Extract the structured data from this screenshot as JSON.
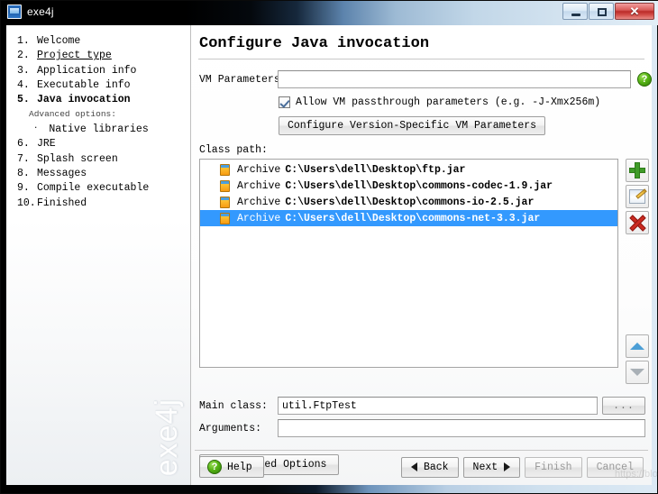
{
  "window": {
    "title": "exe4j",
    "app_icon": "exe4j-app-icon",
    "controls": {
      "minimize": "minimize-icon",
      "maximize": "maximize-icon",
      "close": "✕"
    }
  },
  "sidebar": {
    "steps": [
      {
        "num": "1.",
        "label": "Welcome",
        "state": "done"
      },
      {
        "num": "2.",
        "label": "Project type",
        "state": "visited"
      },
      {
        "num": "3.",
        "label": "Application info",
        "state": "done"
      },
      {
        "num": "4.",
        "label": "Executable info",
        "state": "done"
      },
      {
        "num": "5.",
        "label": "Java invocation",
        "state": "current"
      }
    ],
    "advanced_label": "Advanced options:",
    "advanced_items": [
      {
        "bullet": "·",
        "label": "Native libraries"
      }
    ],
    "steps_after": [
      {
        "num": "6.",
        "label": "JRE",
        "state": "todo"
      },
      {
        "num": "7.",
        "label": "Splash screen",
        "state": "todo"
      },
      {
        "num": "8.",
        "label": "Messages",
        "state": "todo"
      },
      {
        "num": "9.",
        "label": "Compile executable",
        "state": "todo"
      },
      {
        "num": "10.",
        "label": "Finished",
        "state": "todo"
      }
    ],
    "watermark": "exe4j"
  },
  "main": {
    "page_title": "Configure Java invocation",
    "vm_parameters": {
      "label": "VM Parameters:",
      "value": "",
      "help_icon": "?"
    },
    "passthrough": {
      "label": "Allow VM passthrough parameters (e.g. -J-Xmx256m)",
      "checked": true
    },
    "version_specific_button": "Configure Version-Specific VM Parameters",
    "classpath": {
      "label": "Class path:",
      "items": [
        {
          "type": "Archive",
          "path": "C:\\Users\\dell\\Desktop\\ftp.jar",
          "selected": false
        },
        {
          "type": "Archive",
          "path": "C:\\Users\\dell\\Desktop\\commons-codec-1.9.jar",
          "selected": false
        },
        {
          "type": "Archive",
          "path": "C:\\Users\\dell\\Desktop\\commons-io-2.5.jar",
          "selected": false
        },
        {
          "type": "Archive",
          "path": "C:\\Users\\dell\\Desktop\\commons-net-3.3.jar",
          "selected": true
        }
      ],
      "tools": {
        "add": "add-icon",
        "edit": "edit-icon",
        "remove": "remove-icon",
        "move_up": "move-up-icon",
        "move_down": "move-down-icon"
      }
    },
    "main_class": {
      "label": "Main class:",
      "value": "util.FtpTest",
      "browse_label": "..."
    },
    "arguments": {
      "label": "Arguments:",
      "value": "",
      "placeholder": ""
    },
    "advanced_options_button": "Advanced Options"
  },
  "footer": {
    "help": "Help",
    "back": "Back",
    "next": "Next",
    "finish": "Finish",
    "cancel": "Cancel",
    "finish_enabled": false,
    "cancel_enabled": false
  },
  "overlay_watermark": "https://blog.csdn.net/"
}
